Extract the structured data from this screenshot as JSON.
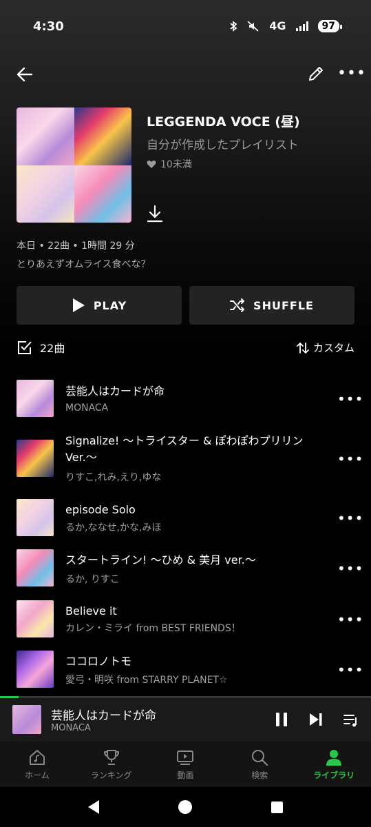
{
  "status_bar": {
    "time": "4:30",
    "network": "4G",
    "battery": "97"
  },
  "playlist": {
    "title": "LEGGENDA VOCE (昼)",
    "subtitle": "自分が作成したプレイリスト",
    "likes": "10未満",
    "meta": "本日 • 22曲 • 1時間 29 分",
    "description": "とりあえずオムライス食べな？"
  },
  "actions": {
    "play_label": "PLAY",
    "shuffle_label": "SHUFFLE"
  },
  "list_header": {
    "count": "22曲",
    "sort": "カスタム"
  },
  "tracks": [
    {
      "title": "芸能人はカードが命",
      "artist": "MONACA",
      "art_color": "#e8b8e0"
    },
    {
      "title": "Signalize! 〜トライスター & ぽわぽわプリリン Ver.〜",
      "artist": "りすこ,れみ,えり,ゆな",
      "art_color": "#2b3a8a"
    },
    {
      "title": "episode Solo",
      "artist": "るか,ななせ,かな,みほ",
      "art_color": "#fbe8c8"
    },
    {
      "title": "スタートライン! 〜ひめ & 美月 ver.〜",
      "artist": "るか, りすこ",
      "art_color": "#f48cb8"
    },
    {
      "title": "Believe it",
      "artist": "カレン・ミライ from BEST FRIENDS！",
      "art_color": "#f9d0e0"
    },
    {
      "title": "ココロノトモ",
      "artist": "愛弓・明咲 from STARRY PLANET☆",
      "art_color": "#8a5ad8"
    }
  ],
  "now_playing": {
    "title": "芸能人はカードが命",
    "artist": "MONACA",
    "progress": 0.05
  },
  "nav": {
    "home": "ホーム",
    "ranking": "ランキング",
    "video": "動画",
    "search": "検索",
    "library": "ライブラリ"
  },
  "colors": {
    "accent": "#27c84a",
    "button_bg": "#232323",
    "bg": "#000000"
  }
}
